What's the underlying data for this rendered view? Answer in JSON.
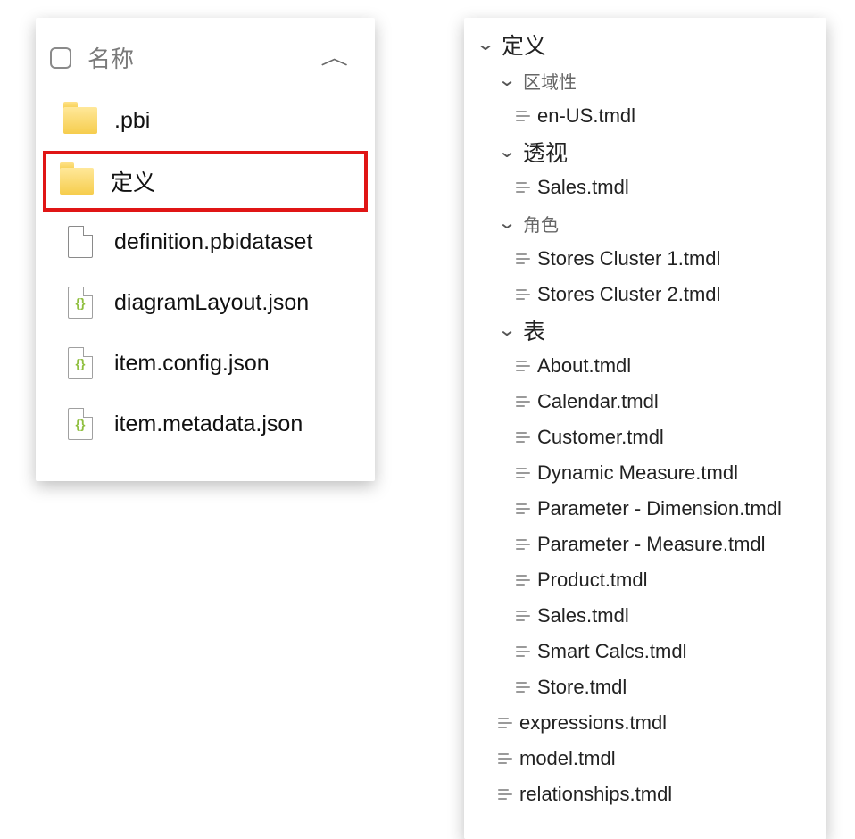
{
  "filePanel": {
    "header": "名称",
    "rows": [
      {
        "type": "folder",
        "label": ".pbi",
        "highlight": false
      },
      {
        "type": "folder",
        "label": "定义",
        "highlight": true
      },
      {
        "type": "file",
        "label": "definition.pbidataset",
        "highlight": false
      },
      {
        "type": "json",
        "label": "diagramLayout.json",
        "highlight": false
      },
      {
        "type": "json",
        "label": "item.config.json",
        "highlight": false
      },
      {
        "type": "json",
        "label": "item.metadata.json",
        "highlight": false
      }
    ]
  },
  "treePanel": {
    "nodes": [
      {
        "indent": 0,
        "kind": "expander",
        "label": "定义",
        "style": "large"
      },
      {
        "indent": 1,
        "kind": "expander",
        "label": "区域性",
        "style": "dim"
      },
      {
        "indent": 2,
        "kind": "file",
        "label": "en-US.tmdl"
      },
      {
        "indent": 1,
        "kind": "expander",
        "label": "透视",
        "style": "large"
      },
      {
        "indent": 2,
        "kind": "file",
        "label": "Sales.tmdl"
      },
      {
        "indent": 1,
        "kind": "expander",
        "label": "角色",
        "style": "dim"
      },
      {
        "indent": 2,
        "kind": "file",
        "label": "Stores Cluster 1.tmdl"
      },
      {
        "indent": 2,
        "kind": "file",
        "label": "Stores Cluster 2.tmdl"
      },
      {
        "indent": 1,
        "kind": "expander",
        "label": "表",
        "style": "large"
      },
      {
        "indent": 2,
        "kind": "file",
        "label": "About.tmdl"
      },
      {
        "indent": 2,
        "kind": "file",
        "label": "Calendar.tmdl"
      },
      {
        "indent": 2,
        "kind": "file",
        "label": "Customer.tmdl"
      },
      {
        "indent": 2,
        "kind": "file",
        "label": "Dynamic Measure.tmdl"
      },
      {
        "indent": 2,
        "kind": "file",
        "label": "Parameter - Dimension.tmdl"
      },
      {
        "indent": 2,
        "kind": "file",
        "label": "Parameter - Measure.tmdl"
      },
      {
        "indent": 2,
        "kind": "file",
        "label": "Product.tmdl"
      },
      {
        "indent": 2,
        "kind": "file",
        "label": "Sales.tmdl"
      },
      {
        "indent": 2,
        "kind": "file",
        "label": "Smart Calcs.tmdl"
      },
      {
        "indent": 2,
        "kind": "file",
        "label": "Store.tmdl"
      },
      {
        "indent": 1,
        "kind": "file",
        "label": "expressions.tmdl"
      },
      {
        "indent": 1,
        "kind": "file",
        "label": "model.tmdl"
      },
      {
        "indent": 1,
        "kind": "file",
        "label": "relationships.tmdl"
      }
    ]
  }
}
